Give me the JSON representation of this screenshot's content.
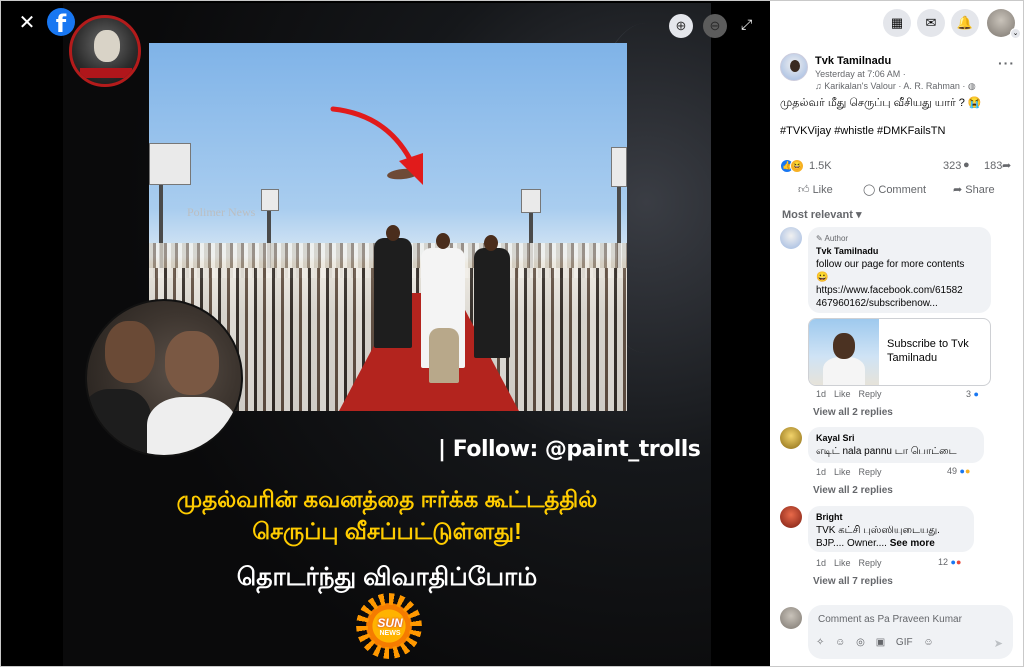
{
  "viewer": {
    "poster": {
      "watermark": "Polimer News",
      "follow_text": "| Follow: @paint_trolls",
      "headline_line1": "முதல்வரின் கவனத்தை ஈர்க்க கூட்டத்தில்",
      "headline_line2": "செருப்பு வீசப்பட்டுள்ளது!",
      "subheadline": "தொடர்ந்து விவாதிப்போம்",
      "logo_text": "SUN",
      "logo_sub": "NEWS"
    },
    "controls": {
      "close_icon": "✕",
      "fb_logo": "f",
      "zoom_in_icon": "⊕",
      "zoom_out_icon": "⊖",
      "expand_icon": "⤢"
    }
  },
  "topbar": {
    "menu_icon": "▦",
    "messenger_icon": "✉",
    "bell_icon": "🔔",
    "chevron": "⌄"
  },
  "post": {
    "page_name": "Tvk Tamilnadu",
    "time": "Yesterday at 7:06 AM ·",
    "audio": "♫ Karikalan's Valour · A. R. Rahman · ◍",
    "more": "···",
    "text": "முதல்வர் மீது செருப்பு வீசியது யார் ? 😭",
    "hashtags": "#TVKVijay #whistle #DMKFailsTN",
    "reaction_count": "1.5K",
    "comments_count": "323",
    "shares_count": "183",
    "like_label": "Like",
    "comment_label": "Comment",
    "share_label": "Share",
    "sort_label": "Most relevant ▾"
  },
  "comments": [
    {
      "author_badge": "✎ Author",
      "name": "Tvk Tamilnadu",
      "text_line1": "follow our page for more contents",
      "text_line2": "😀",
      "link_line1": "https://www.facebook.com/61582",
      "link_line2": "467960162/subscribenow...",
      "card_text": "Subscribe to Tvk Tamilnadu",
      "time": "1d",
      "like": "Like",
      "reply": "Reply",
      "react_count": "3",
      "view_replies": "View all 2 replies"
    },
    {
      "name": "Kayal Sri",
      "text": "எடிட் nala pannu டா பொட்டை",
      "time": "1d",
      "like": "Like",
      "reply": "Reply",
      "react_count": "49",
      "view_replies": "View all 2 replies"
    },
    {
      "name": "Bright",
      "text_line1": "TVK கட்சி புஸ்ஸியுடையது.",
      "text_line2": "BJP.... Owner....",
      "see_more": "See more",
      "time": "1d",
      "like": "Like",
      "reply": "Reply",
      "react_count": "12",
      "view_replies": "View all 7 replies"
    }
  ],
  "comment_box": {
    "placeholder": "Comment as Pa Praveen Kumar",
    "tools": [
      "✧",
      "☺",
      "◎",
      "▣",
      "GIF",
      "☺"
    ],
    "send_icon": "➤"
  },
  "colors": {
    "fb_blue": "#1877f2",
    "poster_yellow": "#ffcc00",
    "bubble_bg": "#f0f2f5"
  }
}
